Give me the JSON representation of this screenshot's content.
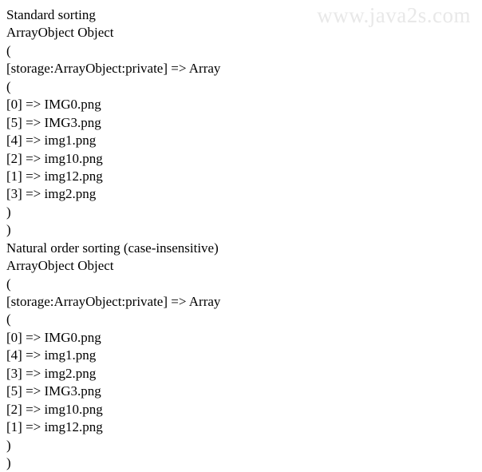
{
  "watermark": "www.java2s.com",
  "lines": [
    "Standard sorting",
    "ArrayObject Object",
    "(",
    "[storage:ArrayObject:private] => Array",
    "(",
    "[0] => IMG0.png",
    "[5] => IMG3.png",
    "[4] => img1.png",
    "[2] => img10.png",
    "[1] => img12.png",
    "[3] => img2.png",
    ")",
    ")",
    "Natural order sorting (case-insensitive)",
    "ArrayObject Object",
    "(",
    "[storage:ArrayObject:private] => Array",
    "(",
    "[0] => IMG0.png",
    "[4] => img1.png",
    "[3] => img2.png",
    "[5] => IMG3.png",
    "[2] => img10.png",
    "[1] => img12.png",
    ")",
    ")"
  ]
}
